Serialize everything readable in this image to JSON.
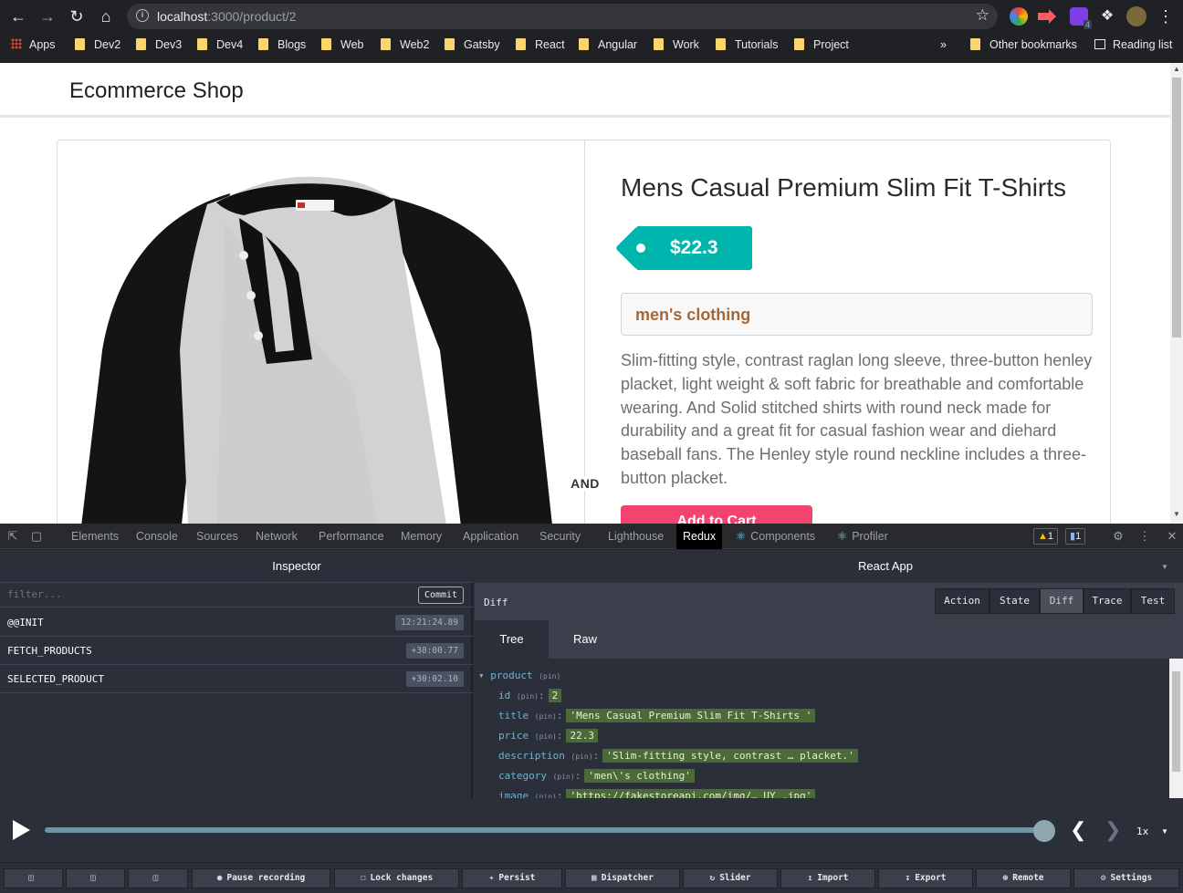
{
  "browser": {
    "url_host": "localhost",
    "url_path": ":3000/product/2",
    "bookmarks": [
      "Apps",
      "Dev2",
      "Dev3",
      "Dev4",
      "Blogs",
      "Web",
      "Web2",
      "Gatsby",
      "React",
      "Angular",
      "Work",
      "Tutorials",
      "Project"
    ],
    "overflow": "»",
    "other_bookmarks": "Other bookmarks",
    "reading_list": "Reading list",
    "ext_badge": "4"
  },
  "page": {
    "brand": "Ecommerce Shop",
    "product_title": "Mens Casual Premium Slim Fit T-Shirts",
    "price": "$22.3",
    "category": "men's clothing",
    "description": "Slim-fitting style, contrast raglan long sleeve, three-button henley placket, light weight & soft fabric for breathable and comfortable wearing. And Solid stitched shirts with round neck made for durability and a great fit for casual fashion wear and diehard baseball fans. The Henley style round neckline includes a three-button placket.",
    "divider_label": "AND",
    "add_to_cart": "Add to Cart"
  },
  "devtools": {
    "tabs": [
      "Elements",
      "Console",
      "Sources",
      "Network",
      "Performance",
      "Memory",
      "Application",
      "Security",
      "Lighthouse",
      "Redux",
      "Components",
      "Profiler"
    ],
    "active_tab": "Redux",
    "warnings": "1",
    "messages": "1"
  },
  "redux": {
    "inspector_title": "Inspector",
    "instance": "React App",
    "filter_placeholder": "filter...",
    "commit": "Commit",
    "actions": [
      {
        "name": "@@INIT",
        "time": "12:21:24.89"
      },
      {
        "name": "FETCH_PRODUCTS",
        "time": "+30:00.77"
      },
      {
        "name": "SELECTED_PRODUCT",
        "time": "+30:02.10"
      }
    ],
    "diff_label": "Diff",
    "monitor_tabs": [
      "Action",
      "State",
      "Diff",
      "Trace",
      "Test"
    ],
    "active_monitor": "Diff",
    "view_tabs": [
      "Tree",
      "Raw"
    ],
    "tree": {
      "root": "product",
      "pin": "(pin)",
      "entries": [
        {
          "key": "id",
          "value": "2"
        },
        {
          "key": "title",
          "value": "'Mens Casual Premium Slim Fit T-Shirts '"
        },
        {
          "key": "price",
          "value": "22.3"
        },
        {
          "key": "description",
          "value": "'Slim-fitting style, contrast … placket.'"
        },
        {
          "key": "category",
          "value": "'men\\'s clothing'"
        },
        {
          "key": "image",
          "value": "'https://fakestoreapi.com/img/… UY .jpg'"
        }
      ]
    },
    "speed": "1x",
    "bottom_buttons": [
      "Pause recording",
      "Lock changes",
      "Persist",
      "Dispatcher",
      "Slider",
      "Import",
      "Export",
      "Remote",
      "Settings"
    ]
  }
}
